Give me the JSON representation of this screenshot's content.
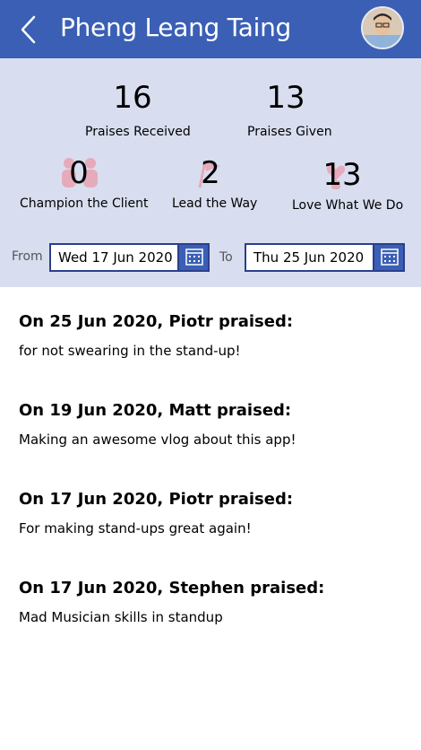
{
  "header": {
    "title": "Pheng Leang Taing"
  },
  "stats": {
    "praises_received": {
      "value": "16",
      "label": "Praises Received"
    },
    "praises_given": {
      "value": "13",
      "label": "Praises Given"
    },
    "values": [
      {
        "value": "0",
        "label": "Champion the Client",
        "icon": "people-icon"
      },
      {
        "value": "2",
        "label": "Lead the Way",
        "icon": "flag-icon"
      },
      {
        "value": "13",
        "label": "Love What We Do",
        "icon": "heart-hands-icon"
      }
    ]
  },
  "date_filter": {
    "from_label": "From",
    "from_value": "Wed 17 Jun 2020",
    "to_label": "To",
    "to_value": "Thu 25 Jun 2020"
  },
  "feed": [
    {
      "heading": "On 25 Jun 2020, Piotr praised:",
      "message": "for not swearing in the stand-up!"
    },
    {
      "heading": "On 19 Jun 2020, Matt praised:",
      "message": "Making an awesome vlog about this app!"
    },
    {
      "heading": "On 17 Jun 2020, Piotr praised:",
      "message": "For making stand-ups great again!"
    },
    {
      "heading": "On 17 Jun 2020, Stephen praised:",
      "message": "Mad Musician skills in standup"
    }
  ],
  "colors": {
    "header_bg": "#3a5fb5",
    "stats_bg": "#d8deef",
    "accent": "#2c3e8e",
    "deco": "#e8a3b3"
  }
}
